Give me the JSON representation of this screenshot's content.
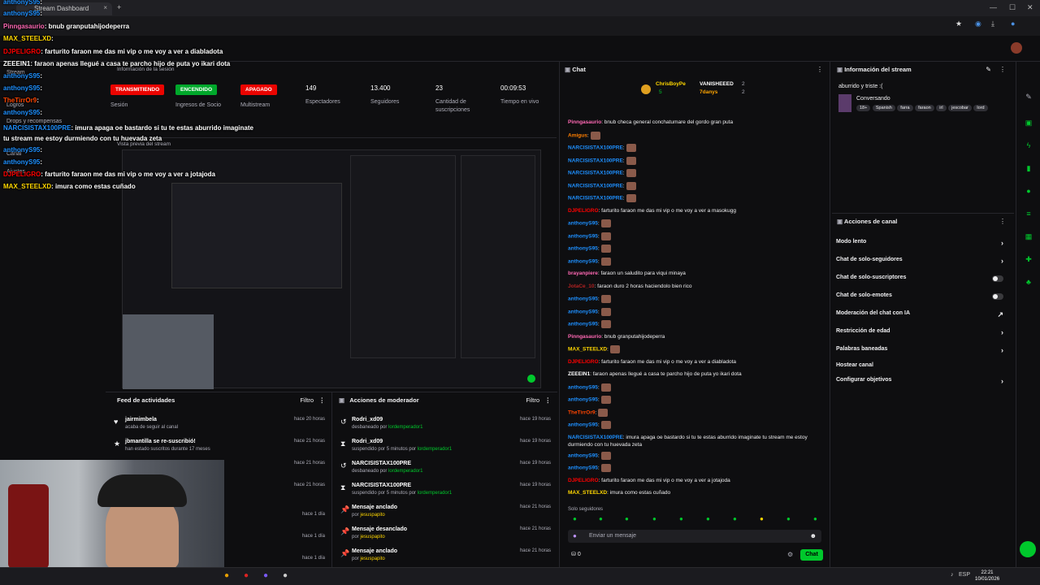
{
  "browser": {
    "tab_title": "Stream Dashboard",
    "new_tab": "+"
  },
  "stream_info": {
    "section_label": "Información de la sesión",
    "badges": [
      {
        "label": "TRANSMITIENDO",
        "sub": "Sesión",
        "color": "#eb0400"
      },
      {
        "label": "ENCENDIDO",
        "sub": "Ingresos de Socio",
        "color": "#00a82b"
      },
      {
        "label": "APAGADO",
        "sub": "Multistream",
        "color": "#eb0400"
      }
    ],
    "stats": [
      {
        "value": "149",
        "label": "Espectadores"
      },
      {
        "value": "13.400",
        "label": "Seguidores"
      },
      {
        "value": "23",
        "label": "Cantidad de suscripciones"
      },
      {
        "value": "00:09:53",
        "label": "Tiempo en vivo"
      }
    ]
  },
  "left_nav": {
    "items": [
      "Stream",
      "Logros",
      "Drops y recompensas",
      "Canal",
      "Ajustes"
    ]
  },
  "preview": {
    "label": "Vista previa del stream"
  },
  "activity_feed": {
    "title": "Feed de actividades",
    "filter": "Filtro",
    "items": [
      {
        "icon": "♥",
        "name": "jairmimbela",
        "sub": "acaba de seguir al canal",
        "time": "hace 20 horas"
      },
      {
        "icon": "★",
        "name": "jbmantilla se re-suscribió!",
        "sub": "han estado suscritos durante 17 meses",
        "time": "hace 21 horas"
      },
      {
        "icon": "",
        "name": "",
        "sub": "",
        "time": "hace 21 horas"
      },
      {
        "icon": "",
        "name": "",
        "sub": "",
        "time": "hace 21 horas"
      },
      {
        "icon": "",
        "name": "",
        "sub": "",
        "time": "hace 1 día"
      },
      {
        "icon": "",
        "name": "",
        "sub": "",
        "time": "hace 1 día"
      },
      {
        "icon": "",
        "name": "",
        "sub": "",
        "time": "hace 1 día"
      }
    ]
  },
  "mod_actions": {
    "title": "Acciones de moderador",
    "filter": "Filtro",
    "items": [
      {
        "icon": "↺",
        "name": "Rodri_xd09",
        "sub": "desbaneado por",
        "by": "lordemperador1",
        "time": "hace 19 horas"
      },
      {
        "icon": "⧗",
        "name": "Rodri_xd09",
        "sub": "suspendido por 5 minutos por",
        "by": "lordemperador1",
        "time": "hace 19 horas"
      },
      {
        "icon": "↺",
        "name": "NARCISISTAX100PRE",
        "sub": "desbaneado por",
        "by": "lordemperador1",
        "time": "hace 19 horas"
      },
      {
        "icon": "⧗",
        "name": "NARCISISTAX100PRE",
        "sub": "suspendido por 5 minutos por",
        "by": "lordemperador1",
        "time": "hace 19 horas"
      },
      {
        "icon": "📌",
        "name": "Mensaje anclado",
        "sub": "por",
        "by": "jesuspapito",
        "time": "hace 21 horas"
      },
      {
        "icon": "📌",
        "name": "Mensaje desanclado",
        "sub": "por",
        "by": "jesuspapito",
        "time": "hace 21 horas"
      },
      {
        "icon": "📌",
        "name": "Mensaje anclado",
        "sub": "por",
        "by": "jesuspapito",
        "time": "hace 21 horas"
      }
    ]
  },
  "chat": {
    "title": "Chat",
    "pinned_users": [
      {
        "name": "ChrisBoyPe",
        "count": "5"
      },
      {
        "name": "VANISHEEED",
        "count": "2"
      },
      {
        "name": "7danys",
        "count": "2"
      }
    ],
    "messages": [
      {
        "user": "Pinngasaurio",
        "color": "#ff69b4",
        "text": ": bnub checa general conchatumare del gordo gran puta",
        "emote": false
      },
      {
        "user": "Amigus",
        "color": "#ff7f00",
        "text": ":",
        "emote": true
      },
      {
        "user": "NARCISISTAX100PRE",
        "color": "#1e90ff",
        "text": ":",
        "emote": true
      },
      {
        "user": "NARCISISTAX100PRE",
        "color": "#1e90ff",
        "text": ":",
        "emote": true
      },
      {
        "user": "NARCISISTAX100PRE",
        "color": "#1e90ff",
        "text": ":",
        "emote": true
      },
      {
        "user": "NARCISISTAX100PRE",
        "color": "#1e90ff",
        "text": ":",
        "emote": true
      },
      {
        "user": "NARCISISTAX100PRE",
        "color": "#1e90ff",
        "text": ":",
        "emote": true
      },
      {
        "user": "DJPELIGRO",
        "color": "#ff0000",
        "text": ": farturito faraon me das mi vip o me voy a ver a masokugg",
        "emote": false
      },
      {
        "user": "anthonyS95",
        "color": "#1e90ff",
        "text": ":",
        "emote": true
      },
      {
        "user": "anthonyS95",
        "color": "#1e90ff",
        "text": ":",
        "emote": true
      },
      {
        "user": "anthonyS95",
        "color": "#1e90ff",
        "text": ":",
        "emote": true
      },
      {
        "user": "anthonyS95",
        "color": "#1e90ff",
        "text": ":",
        "emote": true
      },
      {
        "user": "brayanpiere",
        "color": "#ff69b4",
        "text": ": faraon un saludito para viqui minaya",
        "emote": false
      },
      {
        "user": "JotaCe_10",
        "color": "#b22222",
        "text": ": faraon duro 2 horas haciendolo bien rico",
        "emote": false
      },
      {
        "user": "anthonyS95",
        "color": "#1e90ff",
        "text": ":",
        "emote": true
      },
      {
        "user": "anthonyS95",
        "color": "#1e90ff",
        "text": ":",
        "emote": true
      },
      {
        "user": "anthonyS95",
        "color": "#1e90ff",
        "text": ":",
        "emote": true
      },
      {
        "user": "Pinngasaurio",
        "color": "#ff69b4",
        "text": ": bnub granputahijodeperra",
        "emote": false
      },
      {
        "user": "MAX_STEELXD",
        "color": "#ffd700",
        "text": ":",
        "emote": true
      },
      {
        "user": "DJPELIGRO",
        "color": "#ff0000",
        "text": ": farturito faraon me das mi vip o me voy a ver a diabladota",
        "emote": false
      },
      {
        "user": "ZEEEIN1",
        "color": "#ffffff",
        "text": ": faraon apenas llegué a casa te parcho hijo de puta yo ikari dota",
        "emote": false
      },
      {
        "user": "anthonyS95",
        "color": "#1e90ff",
        "text": ":",
        "emote": true
      },
      {
        "user": "anthonyS95",
        "color": "#1e90ff",
        "text": ":",
        "emote": true
      },
      {
        "user": "TheTirrOr9",
        "color": "#ff4500",
        "text": ":",
        "emote": true
      },
      {
        "user": "anthonyS95",
        "color": "#1e90ff",
        "text": ":",
        "emote": true
      },
      {
        "user": "NARCISISTAX100PRE",
        "color": "#1e90ff",
        "text": ": imura apaga oe bastardo si tu te estas aburrido imaginate tu stream me estoy durmiendo con tu huevada zeta",
        "emote": false
      },
      {
        "user": "anthonyS95",
        "color": "#1e90ff",
        "text": ":",
        "emote": true
      },
      {
        "user": "anthonyS95",
        "color": "#1e90ff",
        "text": ":",
        "emote": true
      },
      {
        "user": "DJPELIGRO",
        "color": "#ff0000",
        "text": ": farturito faraon me das mi vip o me voy a ver a jotajoda",
        "emote": false
      },
      {
        "user": "MAX_STEELXD",
        "color": "#ffd700",
        "text": ": imura como estas cuñado",
        "emote": false
      }
    ],
    "mode_label": "Solo seguidores",
    "input_placeholder": "Enviar un mensaje",
    "points": "0",
    "send_label": "Chat"
  },
  "right_panel": {
    "info_title": "Información del stream",
    "stream_title": "aburrido y triste :(",
    "category": "Conversando",
    "tags": [
      "18+",
      "Spanish",
      "farra",
      "faraon",
      "irl",
      "jescobar",
      "lord"
    ],
    "actions_title": "Acciones de canal",
    "actions": [
      {
        "label": "Modo lento",
        "control": "arrow"
      },
      {
        "label": "Chat de solo-seguidores",
        "control": "arrow"
      },
      {
        "label": "Chat de solo-suscriptores",
        "control": "toggle"
      },
      {
        "label": "Chat de solo-emotes",
        "control": "toggle"
      },
      {
        "label": "Moderación del chat con IA",
        "control": "ext"
      },
      {
        "label": "Restricción de edad",
        "control": "arrow"
      },
      {
        "label": "Palabras baneadas",
        "control": "arrow"
      },
      {
        "label": "Hostear canal",
        "control": "none"
      },
      {
        "label": "Configurar objetivos",
        "control": "arrow"
      }
    ]
  },
  "overlay_chat": [
    {
      "user": "anthonyS95",
      "color": "#1e90ff",
      "text": ":"
    },
    {
      "user": "anthonyS95",
      "color": "#1e90ff",
      "text": ":"
    },
    {
      "user": "Pinngasaurio",
      "color": "#ff69b4",
      "text": ": bnub granputahijodeperra"
    },
    {
      "user": "MAX_STEELXD",
      "color": "#ffd700",
      "text": ":"
    },
    {
      "user": "DJPELIGRO",
      "color": "#ff0000",
      "text": ": farturito faraon me das mi vip o me voy a ver a diabladota"
    },
    {
      "user": "ZEEEIN1",
      "color": "#ffffff",
      "text": ": faraon apenas llegué a casa te parcho hijo de puta yo ikari dota"
    },
    {
      "user": "anthonyS95",
      "color": "#1e90ff",
      "text": ":"
    },
    {
      "user": "anthonyS95",
      "color": "#1e90ff",
      "text": ":"
    },
    {
      "user": "TheTirrOr9",
      "color": "#ff4500",
      "text": ":"
    },
    {
      "user": "anthonyS95",
      "color": "#1e90ff",
      "text": ":"
    },
    {
      "user": "NARCISISTAX100PRE",
      "color": "#1e90ff",
      "text": ": imura apaga oe bastardo si tu te estas aburrido imaginate tu stream me estoy durmiendo con tu huevada zeta"
    },
    {
      "user": "anthonyS95",
      "color": "#1e90ff",
      "text": ":"
    },
    {
      "user": "anthonyS95",
      "color": "#1e90ff",
      "text": ":"
    },
    {
      "user": "DJPELIGRO",
      "color": "#ff0000",
      "text": ": farturito faraon me das mi vip o me voy a ver a jotajoda"
    },
    {
      "user": "MAX_STEELXD",
      "color": "#ffd700",
      "text": ": imura como estas cuñado"
    }
  ],
  "taskbar": {
    "time": "22:21",
    "date": "10/01/2026",
    "lang": "ESP"
  }
}
